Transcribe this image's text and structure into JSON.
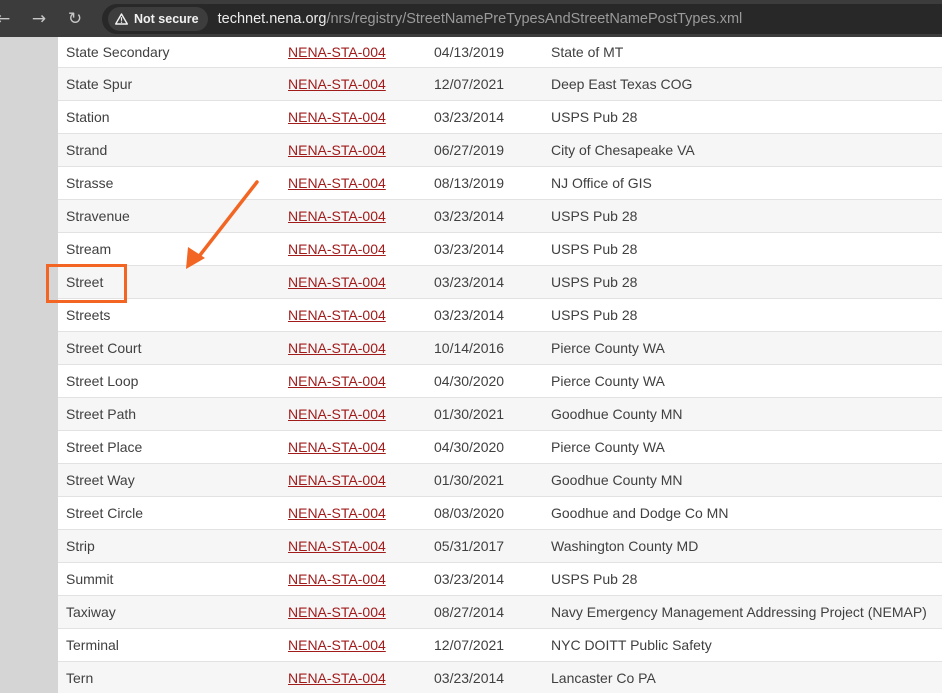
{
  "browser": {
    "nav": {
      "back": "←",
      "forward": "→",
      "reload": "↻"
    },
    "security_label": "Not secure",
    "url_host": "technet.nena.org",
    "url_path": "/nrs/registry/StreetNamePreTypesAndStreetNamePostTypes.xml"
  },
  "table": {
    "rows": [
      {
        "name": "State Secondary",
        "ref": "NENA-STA-004",
        "date": "04/13/2019",
        "source": "State of MT"
      },
      {
        "name": "State Spur",
        "ref": "NENA-STA-004",
        "date": "12/07/2021",
        "source": "Deep East Texas COG"
      },
      {
        "name": "Station",
        "ref": "NENA-STA-004",
        "date": "03/23/2014",
        "source": "USPS Pub 28"
      },
      {
        "name": "Strand",
        "ref": "NENA-STA-004",
        "date": "06/27/2019",
        "source": "City of Chesapeake VA"
      },
      {
        "name": "Strasse",
        "ref": "NENA-STA-004",
        "date": "08/13/2019",
        "source": "NJ Office of GIS"
      },
      {
        "name": "Stravenue",
        "ref": "NENA-STA-004",
        "date": "03/23/2014",
        "source": "USPS Pub 28"
      },
      {
        "name": "Stream",
        "ref": "NENA-STA-004",
        "date": "03/23/2014",
        "source": "USPS Pub 28"
      },
      {
        "name": "Street",
        "ref": "NENA-STA-004",
        "date": "03/23/2014",
        "source": "USPS Pub 28"
      },
      {
        "name": "Streets",
        "ref": "NENA-STA-004",
        "date": "03/23/2014",
        "source": "USPS Pub 28"
      },
      {
        "name": "Street Court",
        "ref": "NENA-STA-004",
        "date": "10/14/2016",
        "source": "Pierce County WA"
      },
      {
        "name": "Street Loop",
        "ref": "NENA-STA-004",
        "date": "04/30/2020",
        "source": "Pierce County WA"
      },
      {
        "name": "Street Path",
        "ref": "NENA-STA-004",
        "date": "01/30/2021",
        "source": "Goodhue County MN"
      },
      {
        "name": "Street Place",
        "ref": "NENA-STA-004",
        "date": "04/30/2020",
        "source": "Pierce County WA"
      },
      {
        "name": "Street Way",
        "ref": "NENA-STA-004",
        "date": "01/30/2021",
        "source": "Goodhue County MN"
      },
      {
        "name": "Street Circle",
        "ref": "NENA-STA-004",
        "date": "08/03/2020",
        "source": "Goodhue and Dodge Co MN"
      },
      {
        "name": "Strip",
        "ref": "NENA-STA-004",
        "date": "05/31/2017",
        "source": "Washington County MD"
      },
      {
        "name": "Summit",
        "ref": "NENA-STA-004",
        "date": "03/23/2014",
        "source": "USPS Pub 28"
      },
      {
        "name": "Taxiway",
        "ref": "NENA-STA-004",
        "date": "08/27/2014",
        "source": "Navy Emergency Management Addressing Project (NEMAP)"
      },
      {
        "name": "Terminal",
        "ref": "NENA-STA-004",
        "date": "12/07/2021",
        "source": "NYC DOITT Public Safety"
      },
      {
        "name": "Tern",
        "ref": "NENA-STA-004",
        "date": "03/23/2014",
        "source": "Lancaster Co PA"
      }
    ]
  },
  "annotation": {
    "color": "#f26522"
  },
  "colors": {
    "link": "#a11b1b",
    "text": "#404040",
    "toolbar": "#3c3c3c"
  }
}
